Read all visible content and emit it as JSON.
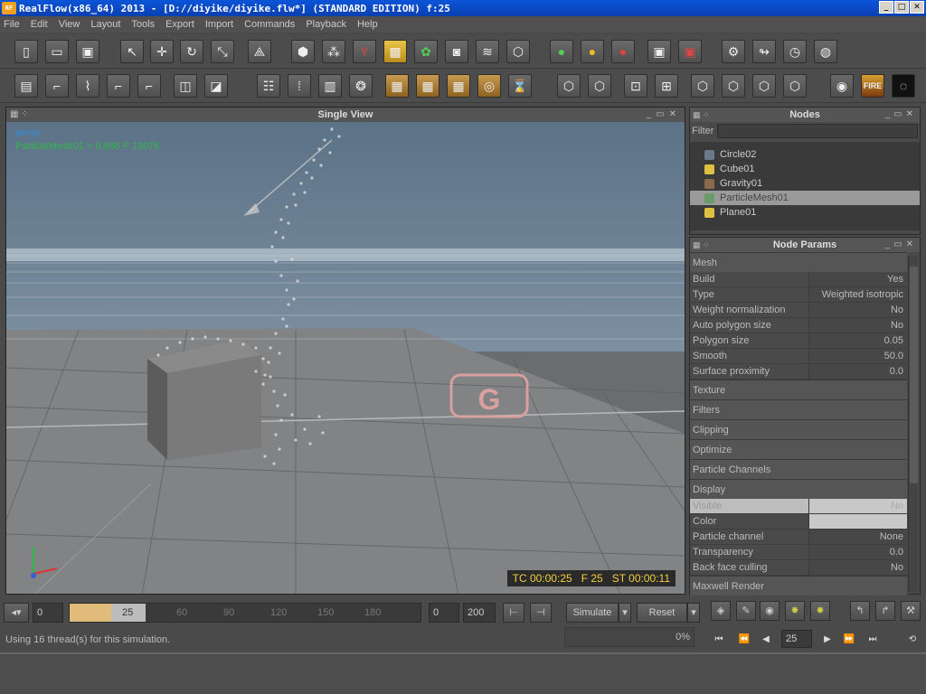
{
  "window": {
    "title": "RealFlow(x86_64) 2013 - [D://diyike/diyike.flw*] (STANDARD EDITION) f:25",
    "app_icon": "RF"
  },
  "menu": [
    "File",
    "Edit",
    "View",
    "Layout",
    "Tools",
    "Export",
    "Import",
    "Commands",
    "Playback",
    "Help"
  ],
  "viewport": {
    "title": "Single View",
    "camera": "persp",
    "info": "ParticleMesh01 > 0.896 F 13076",
    "tc": "TC 00:00:25",
    "frame": "F 25",
    "st": "ST 00:00:11",
    "logo": "G"
  },
  "nodes": {
    "title": "Nodes",
    "filter_label": "Filter",
    "items": [
      {
        "label": "Circle02",
        "icon_color": "#6a7a8a"
      },
      {
        "label": "Cube01",
        "icon_color": "#e0c040"
      },
      {
        "label": "Gravity01",
        "icon_color": "#8a6a4a"
      },
      {
        "label": "ParticleMesh01",
        "icon_color": "#6a9a6a",
        "selected": true
      },
      {
        "label": "Plane01",
        "icon_color": "#e0c040"
      }
    ]
  },
  "params": {
    "title": "Node Params",
    "mesh_section": "Mesh",
    "mesh_rows": [
      {
        "k": "Build",
        "v": "Yes"
      },
      {
        "k": "Type",
        "v": "Weighted isotropic"
      },
      {
        "k": "Weight normalization",
        "v": "No"
      },
      {
        "k": "Auto polygon size",
        "v": "No"
      },
      {
        "k": "Polygon size",
        "v": "0.05"
      },
      {
        "k": "Smooth",
        "v": "50.0"
      },
      {
        "k": "Surface proximity",
        "v": "0.0"
      }
    ],
    "sections": [
      "Texture",
      "Filters",
      "Clipping",
      "Optimize",
      "Particle Channels",
      "Display"
    ],
    "display_rows": [
      {
        "k": "Visible",
        "v": "No"
      },
      {
        "k": "Color",
        "v": ""
      },
      {
        "k": "Particle channel",
        "v": "None"
      },
      {
        "k": "Transparency",
        "v": "0.0"
      },
      {
        "k": "Back face culling",
        "v": "No"
      }
    ],
    "last_section": "Maxwell Render"
  },
  "timeline": {
    "start": "0",
    "frame": "25",
    "ticks": [
      "60",
      "90",
      "120",
      "150",
      "180"
    ],
    "range_start": "0",
    "range_end": "200",
    "simulate": "Simulate",
    "reset": "Reset",
    "current_frame": "25"
  },
  "status": {
    "message": "Using 16 thread(s) for this simulation.",
    "progress": "0%"
  }
}
